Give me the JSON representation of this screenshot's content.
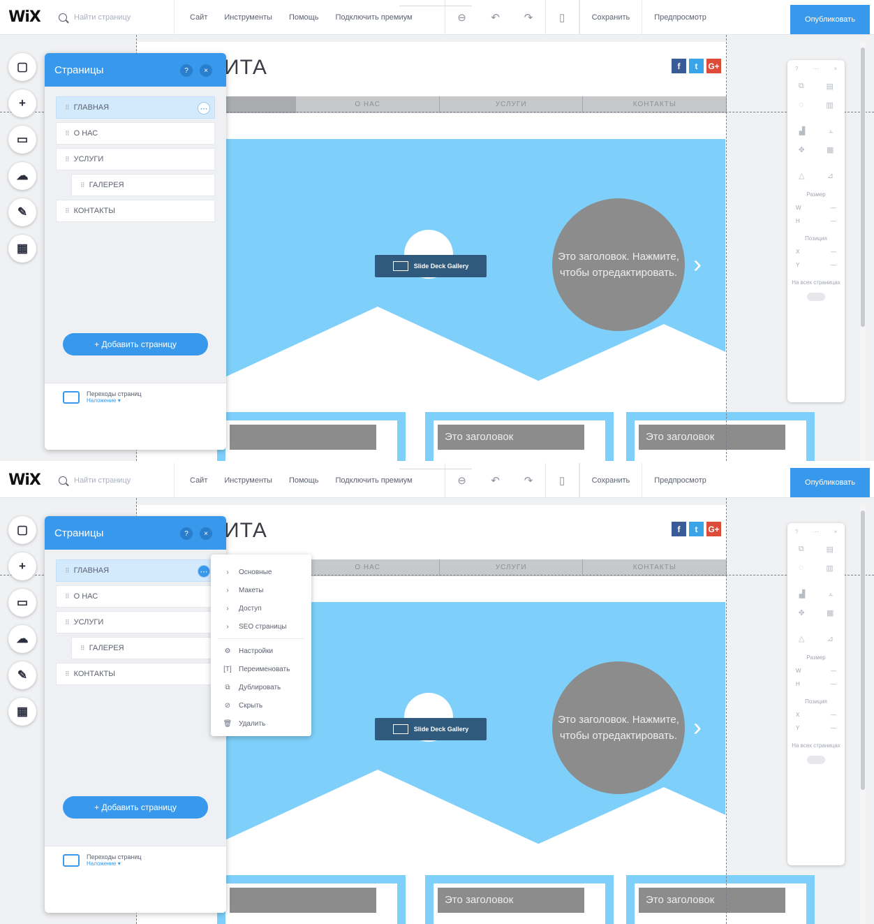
{
  "app": {
    "logo": "WiX",
    "search_placeholder": "Найти страницу",
    "menu": [
      "Сайт",
      "Инструменты",
      "Помощь",
      "Подключить премиум"
    ],
    "actions": {
      "save": "Сохранить",
      "preview": "Предпросмотр",
      "publish": "Опубликовать"
    }
  },
  "site": {
    "title": "ИТА",
    "nav": [
      "",
      "О НАС",
      "УСЛУГИ",
      "КОНТАКТЫ"
    ],
    "hero_text": "Это заголовок. Нажмите, чтобы отредактировать.",
    "gallery_tag": "Slide Deck Gallery",
    "card_title": "Это заголовок",
    "social": [
      "f",
      "t",
      "G+"
    ]
  },
  "pages_panel": {
    "title": "Страницы",
    "items": [
      {
        "label": "ГЛАВНАЯ",
        "active": true,
        "child": false
      },
      {
        "label": "О НАС",
        "active": false,
        "child": false
      },
      {
        "label": "УСЛУГИ",
        "active": false,
        "child": false
      },
      {
        "label": "ГАЛЕРЕЯ",
        "active": false,
        "child": true
      },
      {
        "label": "КОНТАКТЫ",
        "active": false,
        "child": false
      }
    ],
    "add_button": "+ Добавить страницу",
    "transitions_label": "Переходы страниц",
    "transitions_setting": "Наложение ▾"
  },
  "context_menu": {
    "sections": [
      "Основные",
      "Макеты",
      "Доступ",
      "SEO страницы"
    ],
    "actions": [
      "Настройки",
      "Переименовать",
      "Дублировать",
      "Скрыть",
      "Удалить"
    ]
  },
  "props_panel": {
    "size_label": "Размер",
    "position_label": "Позиция",
    "all_pages_label": "На всех страницах",
    "w": "W",
    "h": "H",
    "x": "X",
    "y": "Y"
  },
  "colors": {
    "accent": "#3899ec",
    "hero": "#7ed0fa",
    "placeholder": "#8c8c8c"
  }
}
